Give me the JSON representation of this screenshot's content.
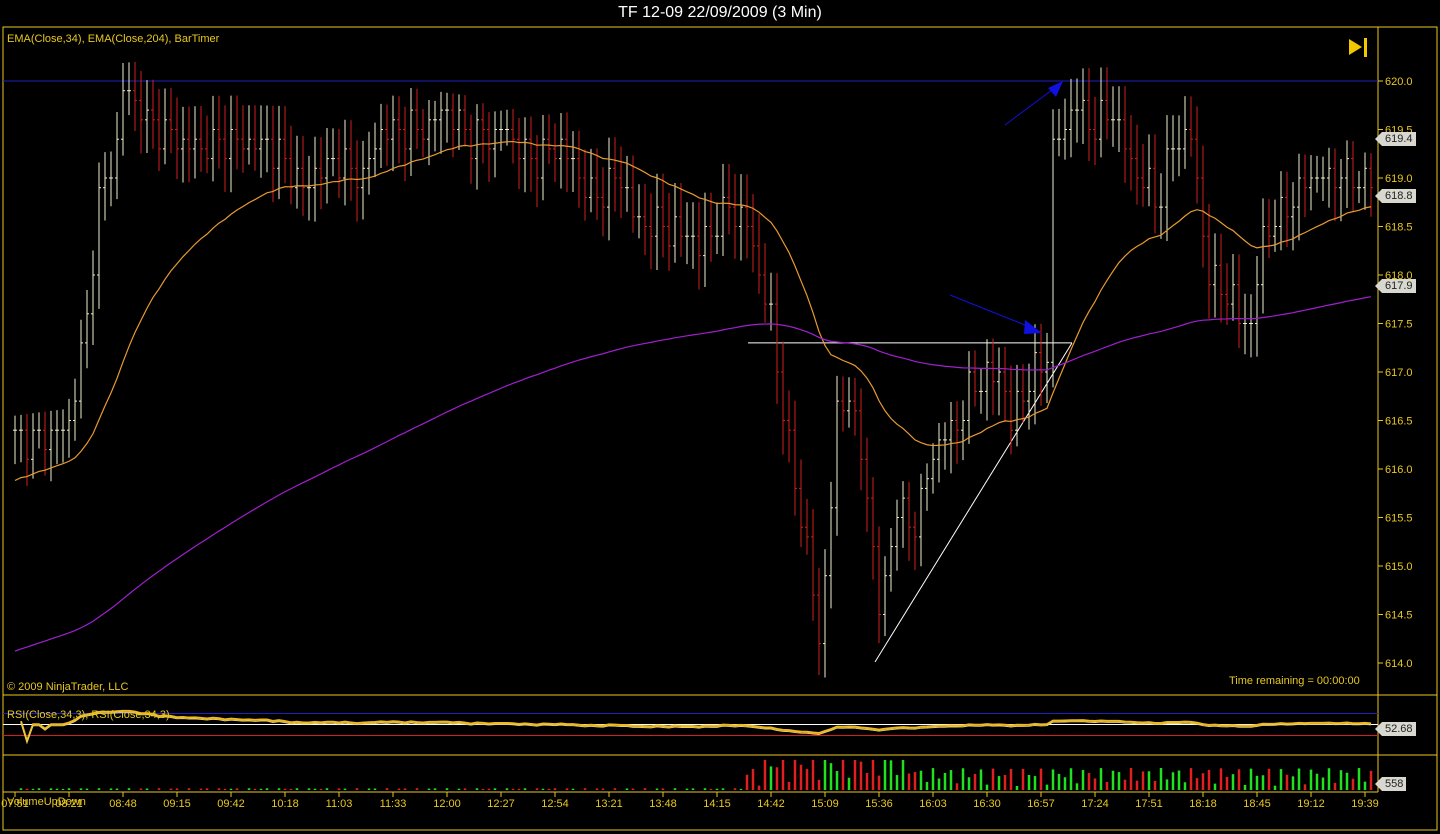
{
  "title": "TF 12-09  22/09/2009 (3 Min)",
  "indicators_label": "EMA(Close,34), EMA(Close,204), BarTimer",
  "copyright": "© 2009 NinjaTrader, LLC",
  "time_remaining": "Time remaining = 00:00:00",
  "rsi_label": "RSI(Close,34,3), RSI(Close,34,3)",
  "volume_label": "VolumeUpDown",
  "tags": {
    "last": "619.4",
    "ema34": "618.8",
    "ema204": "617.9",
    "rsi": "52.68",
    "volume": "558"
  },
  "colors": {
    "axis": "#e8c820",
    "up": "#f0f0d0",
    "down": "#d02020",
    "ema34": "#e89a30",
    "ema204": "#a020d0",
    "hline": "#2020c0",
    "arrows": "#1010e0",
    "vol_up": "#20e020",
    "vol_down": "#e02020"
  },
  "chart_data": {
    "type": "candlestick-bar",
    "yticks": [
      "620.0",
      "619.5",
      "619.0",
      "618.5",
      "618.0",
      "617.5",
      "617.0",
      "616.5",
      "616.0",
      "615.5",
      "615.0",
      "614.5",
      "614.0"
    ],
    "ylim": [
      613.7,
      620.5
    ],
    "xticks": [
      "07:51",
      "08:21",
      "08:48",
      "09:15",
      "09:42",
      "10:18",
      "11:03",
      "11:33",
      "12:00",
      "12:27",
      "12:54",
      "13:21",
      "13:48",
      "14:15",
      "14:42",
      "15:09",
      "15:36",
      "16:03",
      "16:30",
      "16:57",
      "17:24",
      "17:51",
      "18:18",
      "18:45",
      "19:12",
      "19:39"
    ],
    "bars_per_tick": 9,
    "close_path": [
      [
        0,
        616.3
      ],
      [
        4,
        616.3
      ],
      [
        9,
        616.5
      ],
      [
        12,
        617.5
      ],
      [
        14,
        618.8
      ],
      [
        17,
        619.3
      ],
      [
        18,
        619.9
      ],
      [
        21,
        619.7
      ],
      [
        24,
        619.5
      ],
      [
        31,
        619.3
      ],
      [
        38,
        619.4
      ],
      [
        43,
        619.3
      ],
      [
        48,
        618.9
      ],
      [
        53,
        619.2
      ],
      [
        58,
        619.0
      ],
      [
        61,
        619.5
      ],
      [
        68,
        619.5
      ],
      [
        71,
        619.7
      ],
      [
        76,
        619.4
      ],
      [
        81,
        619.5
      ],
      [
        86,
        619.2
      ],
      [
        91,
        619.3
      ],
      [
        96,
        618.8
      ],
      [
        101,
        619.0
      ],
      [
        104,
        618.5
      ],
      [
        109,
        618.5
      ],
      [
        114,
        618.3
      ],
      [
        119,
        618.7
      ],
      [
        122,
        618.5
      ],
      [
        126,
        617.5
      ],
      [
        129,
        616.2
      ],
      [
        132,
        615.2
      ],
      [
        134,
        614.2
      ],
      [
        137,
        616.5
      ],
      [
        139,
        616.8
      ],
      [
        142,
        615.8
      ],
      [
        144,
        614.5
      ],
      [
        147,
        615.6
      ],
      [
        150,
        615.4
      ],
      [
        153,
        616.2
      ],
      [
        157,
        616.5
      ],
      [
        160,
        616.9
      ],
      [
        164,
        617.0
      ],
      [
        166,
        616.5
      ],
      [
        169,
        616.9
      ],
      [
        172,
        617.2
      ],
      [
        173,
        619.3
      ],
      [
        177,
        619.8
      ],
      [
        180,
        619.5
      ],
      [
        183,
        619.7
      ],
      [
        187,
        619.0
      ],
      [
        191,
        618.8
      ],
      [
        193,
        619.4
      ],
      [
        196,
        619.4
      ],
      [
        199,
        618.0
      ],
      [
        202,
        617.8
      ],
      [
        206,
        617.4
      ],
      [
        208,
        618.4
      ],
      [
        213,
        618.8
      ],
      [
        216,
        619.0
      ],
      [
        221,
        619.0
      ],
      [
        226,
        619.0
      ]
    ],
    "ema34_seed": 615.85,
    "ema204_seed": 614.1,
    "reference_line": 620.0,
    "support_line": 617.3,
    "rsi_levels": [
      70,
      50,
      30
    ],
    "volume_last": 558
  }
}
